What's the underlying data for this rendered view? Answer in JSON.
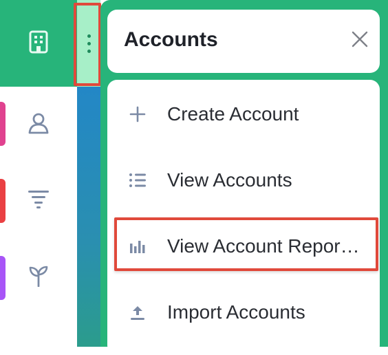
{
  "rail": {
    "items": [
      {
        "icon": "building-icon",
        "active": true
      },
      {
        "icon": "contact-icon",
        "strip_color": "#e0428f"
      },
      {
        "icon": "funnel-icon",
        "strip_color": "#ea4043"
      },
      {
        "icon": "sprout-icon",
        "strip_color": "#a855f7"
      }
    ],
    "accent": "#27b47a"
  },
  "panel": {
    "title": "Accounts",
    "close_icon": "close-icon",
    "items": [
      {
        "label": "Create Account",
        "icon": "plus-icon"
      },
      {
        "label": "View Accounts",
        "icon": "list-icon"
      },
      {
        "label": "View Account Repor…",
        "icon": "bar-chart-icon"
      },
      {
        "label": "Import Accounts",
        "icon": "upload-icon"
      }
    ]
  },
  "colors": {
    "highlight": "#e0493b",
    "panel_green": "#27b47a",
    "kebab_bg": "#a7efc8"
  }
}
